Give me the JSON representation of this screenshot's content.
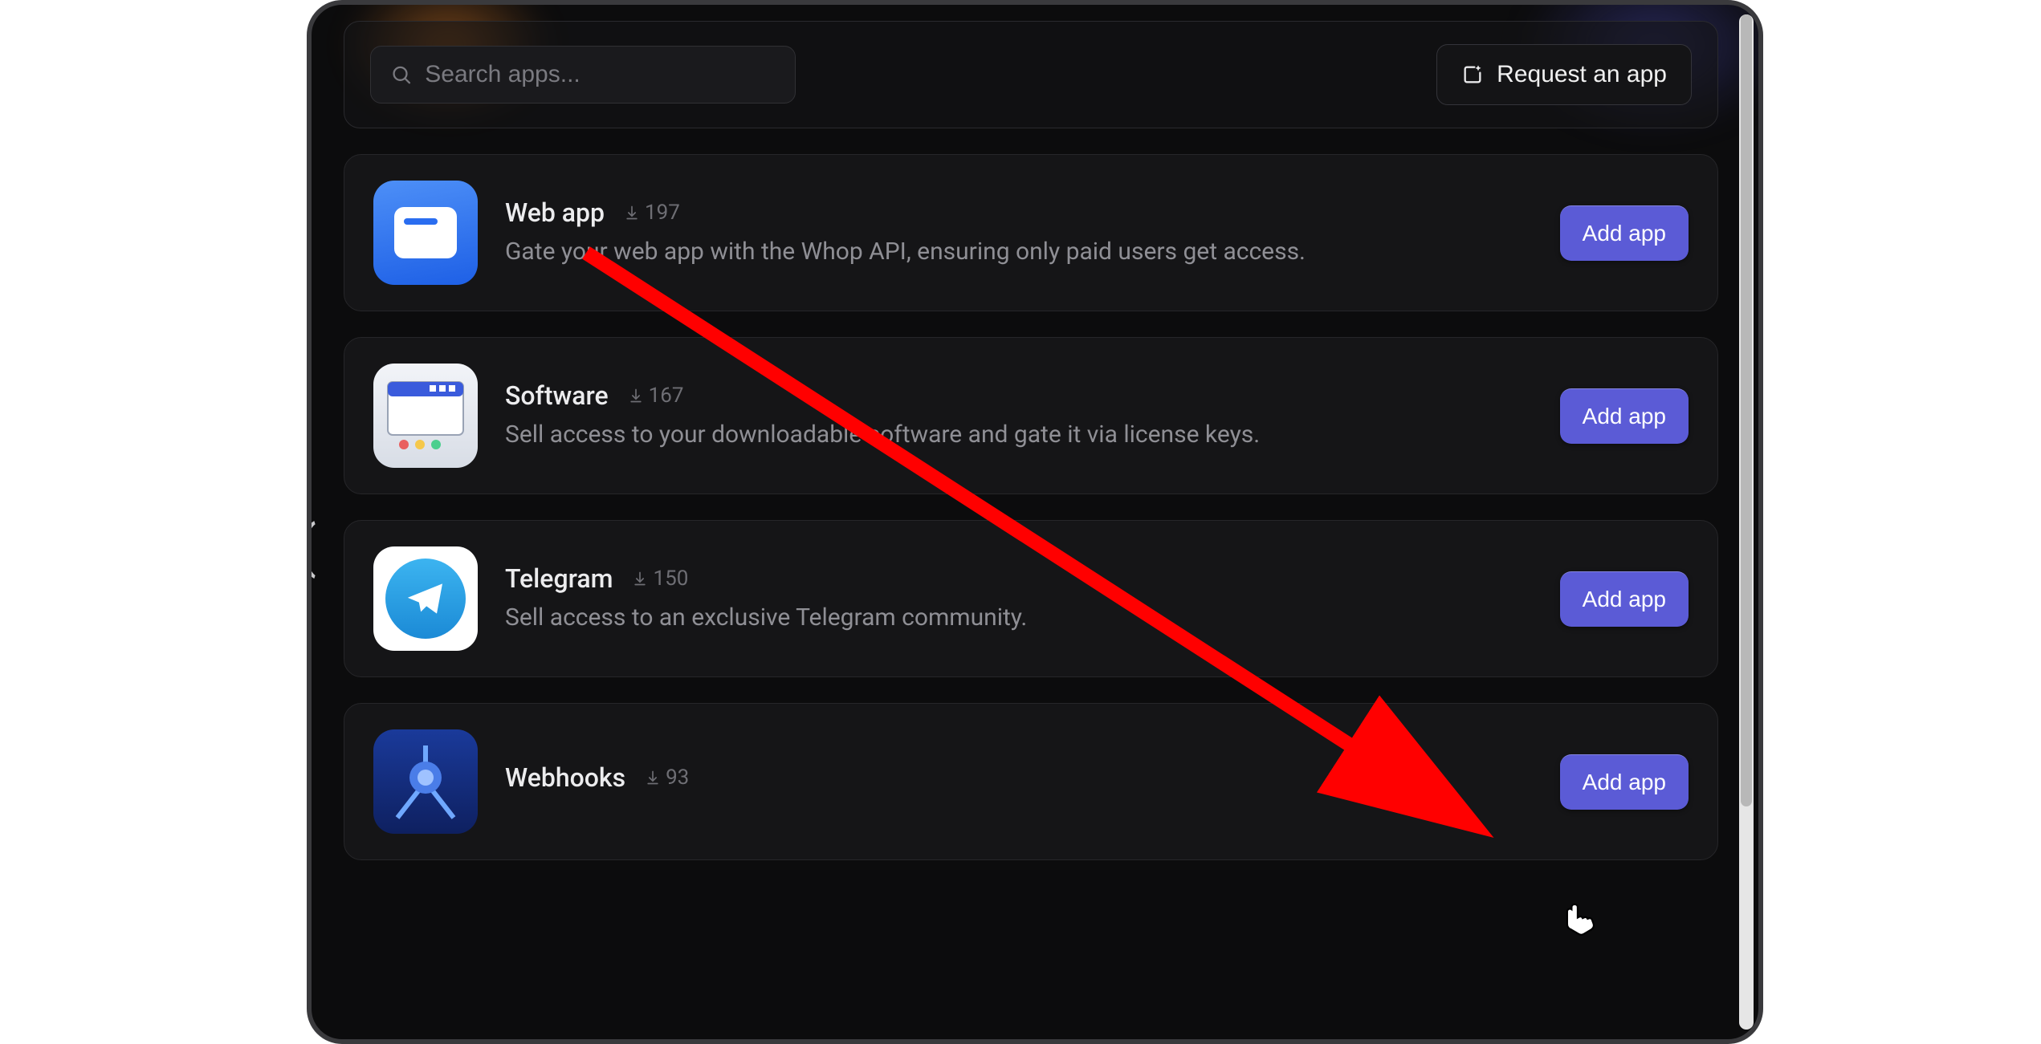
{
  "search": {
    "placeholder": "Search apps..."
  },
  "request_button": {
    "label": "Request an app"
  },
  "add_label": "Add app",
  "apps": [
    {
      "name": "Web app",
      "downloads": "197",
      "description": "Gate your web app with the Whop API, ensuring only paid users get access."
    },
    {
      "name": "Software",
      "downloads": "167",
      "description": "Sell access to your downloadable software and gate it via license keys."
    },
    {
      "name": "Telegram",
      "downloads": "150",
      "description": "Sell access to an exclusive Telegram community."
    },
    {
      "name": "Webhooks",
      "downloads": "93",
      "description": ""
    }
  ],
  "annotation": {
    "target": "Add app (Webhooks)"
  }
}
